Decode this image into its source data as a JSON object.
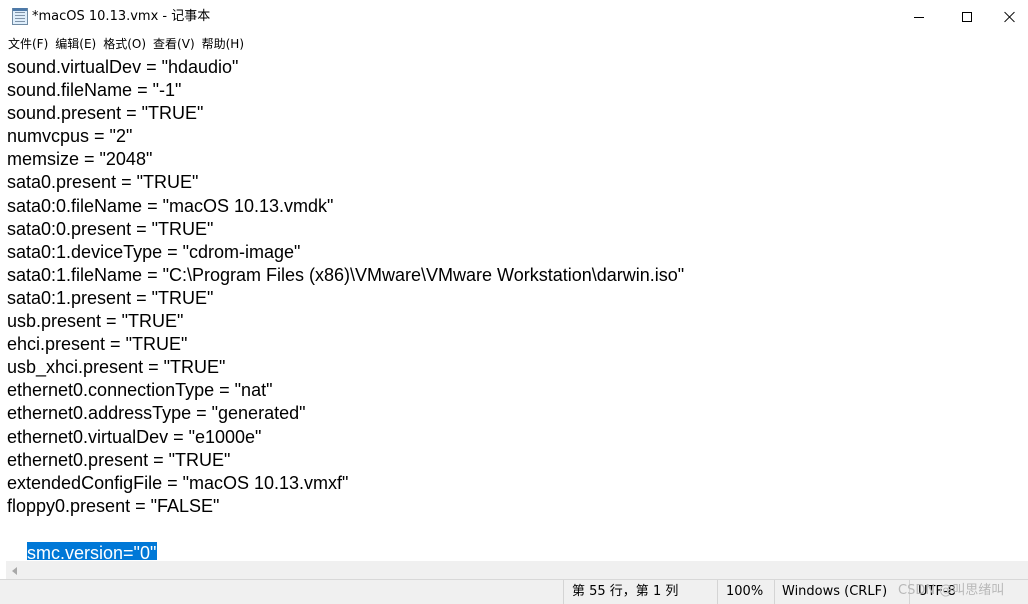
{
  "window": {
    "title": "*macOS 10.13.vmx - 记事本",
    "icon": "notepad-icon",
    "controls": [
      "minimize-icon",
      "maximize-icon",
      "close-icon"
    ]
  },
  "menu": {
    "file": "文件(F)",
    "edit": "编辑(E)",
    "format": "格式(O)",
    "view": "查看(V)",
    "help": "帮助(H)"
  },
  "editor": {
    "lines": [
      "sound.virtualDev = \"hdaudio\"",
      "sound.fileName = \"-1\"",
      "sound.present = \"TRUE\"",
      "numvcpus = \"2\"",
      "memsize = \"2048\"",
      "sata0.present = \"TRUE\"",
      "sata0:0.fileName = \"macOS 10.13.vmdk\"",
      "sata0:0.present = \"TRUE\"",
      "sata0:1.deviceType = \"cdrom-image\"",
      "sata0:1.fileName = \"C:\\Program Files (x86)\\VMware\\VMware Workstation\\darwin.iso\"",
      "sata0:1.present = \"TRUE\"",
      "usb.present = \"TRUE\"",
      "ehci.present = \"TRUE\"",
      "usb_xhci.present = \"TRUE\"",
      "ethernet0.connectionType = \"nat\"",
      "ethernet0.addressType = \"generated\"",
      "ethernet0.virtualDev = \"e1000e\"",
      "ethernet0.present = \"TRUE\"",
      "extendedConfigFile = \"macOS 10.13.vmxf\"",
      "floppy0.present = \"FALSE\"",
      "smc.version=\"0\""
    ],
    "selected_line_index": 20,
    "selection_color": "#0078d7"
  },
  "status": {
    "position": "第 55 行，第 1 列",
    "zoom": "100%",
    "line_ending": "Windows (CRLF)",
    "encoding": "UTF-8"
  },
  "watermark": "CSDN @叫思绪叫"
}
